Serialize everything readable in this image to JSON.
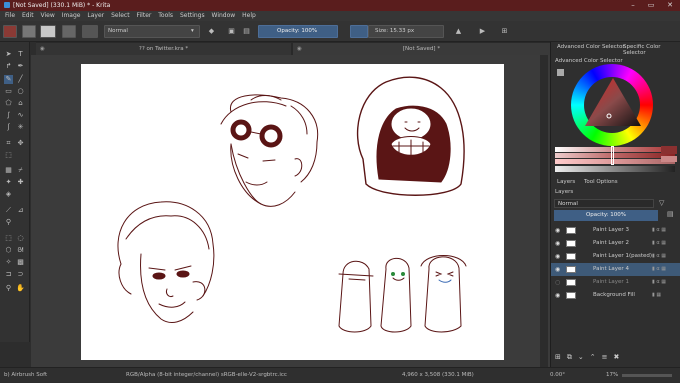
{
  "window": {
    "title": "[Not Saved]  (330.1 MiB)  * - Krita"
  },
  "menu": [
    "File",
    "Edit",
    "View",
    "Image",
    "Layer",
    "Select",
    "Filter",
    "Tools",
    "Settings",
    "Window",
    "Help"
  ],
  "toolbar": {
    "blend_mode": "Normal",
    "opacity": "Opacity: 100%",
    "size": "Size: 15.33 px"
  },
  "tabs": [
    {
      "label": "?? on Twitter.kra *"
    },
    {
      "label": "[Not Saved] *"
    }
  ],
  "right_panel": {
    "tabs": [
      "Advanced Color Selector",
      "Specific Color Selector"
    ],
    "advanced_label": "Advanced Color Selector",
    "layer_tabs": [
      "Layers",
      "Tool Options"
    ],
    "layers_title": "Layers",
    "layer_blend": "Normal",
    "layer_opacity": "Opacity:  100%",
    "layers": [
      {
        "name": "Paint Layer 3",
        "selected": false,
        "dim": false
      },
      {
        "name": "Paint Layer 2",
        "selected": false,
        "dim": false
      },
      {
        "name": "Paint Layer 1(pasted)",
        "selected": false,
        "dim": false
      },
      {
        "name": "Paint Layer 4",
        "selected": true,
        "dim": false
      },
      {
        "name": "Paint Layer 1",
        "selected": false,
        "dim": true
      },
      {
        "name": "Background Fill",
        "selected": false,
        "dim": false
      }
    ]
  },
  "status": {
    "brush": "b) Airbrush Soft",
    "colorspace": "RGB/Alpha (8-bit integer/channel)  sRGB-elle-V2-srgbtrc.icc",
    "dimensions": "4,960 x 3,508 (330.1 MiB)",
    "rotation": "0.00°",
    "zoom": "17%"
  },
  "colors": {
    "accent": "#5a1d1d",
    "selected_layer": "#3e5a78",
    "ink": "#5a1515"
  }
}
